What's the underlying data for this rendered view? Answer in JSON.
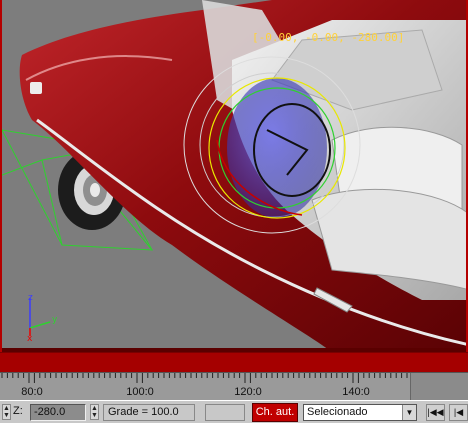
{
  "viewport": {
    "coord_readout": "[-0.00, -0.00, -280.00]",
    "axis": {
      "x": "x",
      "y": "y",
      "z": "z"
    }
  },
  "timeline": {
    "ticks": [
      "80:0",
      "100:0",
      "120:0",
      "140:0"
    ]
  },
  "statusbar": {
    "z_label": "Z:",
    "z_value": "-280.0",
    "grade": "Grade = 100.0",
    "autokey": "Ch. aut.",
    "selection": "Selecionado"
  },
  "colors": {
    "frame_red": "#b40000",
    "car_red": "#8e0b0e",
    "coord_yellow": "#ffd23a",
    "gizmo_blue": "#3333cc",
    "grid_green": "#2fd12f"
  },
  "icons": [
    "spinner-arrows-icon",
    "dropdown-arrow-icon",
    "go-to-start-icon",
    "previous-frame-icon"
  ]
}
